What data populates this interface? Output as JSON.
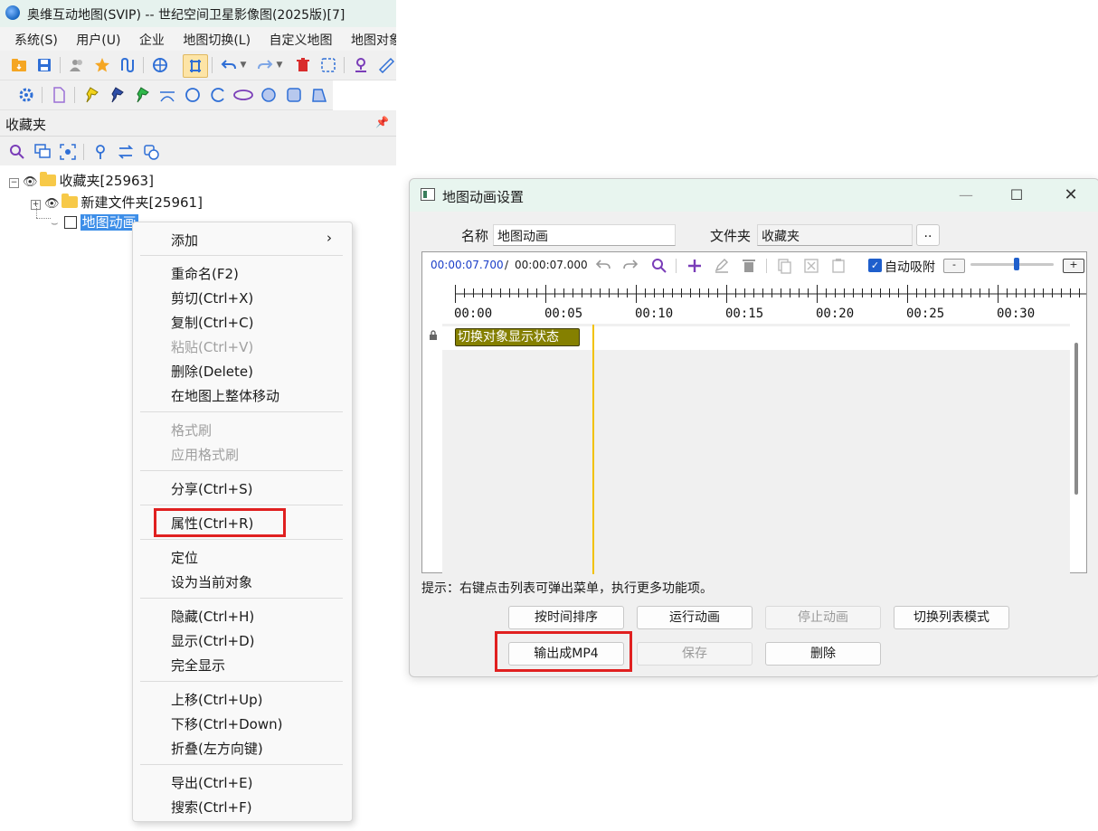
{
  "main_window": {
    "title": "奥维互动地图(SVIP) -- 世纪空间卫星影像图(2025版)[7]",
    "menu": [
      "系统(S)",
      "用户(U)",
      "企业",
      "地图切换(L)",
      "自定义地图",
      "地图对象"
    ]
  },
  "favorites": {
    "panel_title": "收藏夹",
    "pin_icon": "pin-icon",
    "tree": {
      "root": "收藏夹[25963]",
      "folder": "新建文件夹[25961]",
      "animation_item": "地图动画"
    }
  },
  "context_menu": {
    "items": [
      {
        "label": "添加",
        "submenu": true
      },
      {
        "label": "重命名(F2)"
      },
      {
        "label": "剪切(Ctrl+X)"
      },
      {
        "label": "复制(Ctrl+C)"
      },
      {
        "label": "粘贴(Ctrl+V)",
        "disabled": true
      },
      {
        "label": "删除(Delete)"
      },
      {
        "label": "在地图上整体移动"
      },
      {
        "label": "格式刷",
        "disabled": true
      },
      {
        "label": "应用格式刷",
        "disabled": true
      },
      {
        "label": "分享(Ctrl+S)"
      },
      {
        "label": "属性(Ctrl+R)",
        "highlighted": true
      },
      {
        "label": "定位"
      },
      {
        "label": "设为当前对象"
      },
      {
        "label": "隐藏(Ctrl+H)"
      },
      {
        "label": "显示(Ctrl+D)"
      },
      {
        "label": "完全显示"
      },
      {
        "label": "上移(Ctrl+Up)"
      },
      {
        "label": "下移(Ctrl+Down)"
      },
      {
        "label": "折叠(左方向键)"
      },
      {
        "label": "导出(Ctrl+E)"
      },
      {
        "label": "搜索(Ctrl+F)"
      }
    ]
  },
  "dialog": {
    "title": "地图动画设置",
    "name_label": "名称",
    "name_value": "地图动画",
    "folder_label": "文件夹",
    "folder_value": "收藏夹",
    "browse_label": "..",
    "current_time": "00:00:07.700",
    "time_sep": "/",
    "total_time": "00:00:07.000",
    "auto_snap_label": "自动吸附",
    "auto_snap_checked": true,
    "zoom_minus": "-",
    "zoom_plus": "+",
    "tick_labels": [
      "00:00",
      "00:05",
      "00:10",
      "00:15",
      "00:20",
      "00:25",
      "00:30"
    ],
    "clip_label": "切换对象显示状态",
    "hint": "提示：右键点击列表可弹出菜单，执行更多功能项。",
    "buttons": {
      "sort_by_time": "按时间排序",
      "run_animation": "运行动画",
      "stop_animation": "停止动画",
      "switch_list_mode": "切换列表模式",
      "export_mp4": "输出成MP4",
      "save": "保存",
      "delete": "删除"
    }
  },
  "colors": {
    "highlight_box": "#e02020",
    "selection": "#3d8ee8",
    "clip": "#858000",
    "playhead": "#f2c200"
  }
}
